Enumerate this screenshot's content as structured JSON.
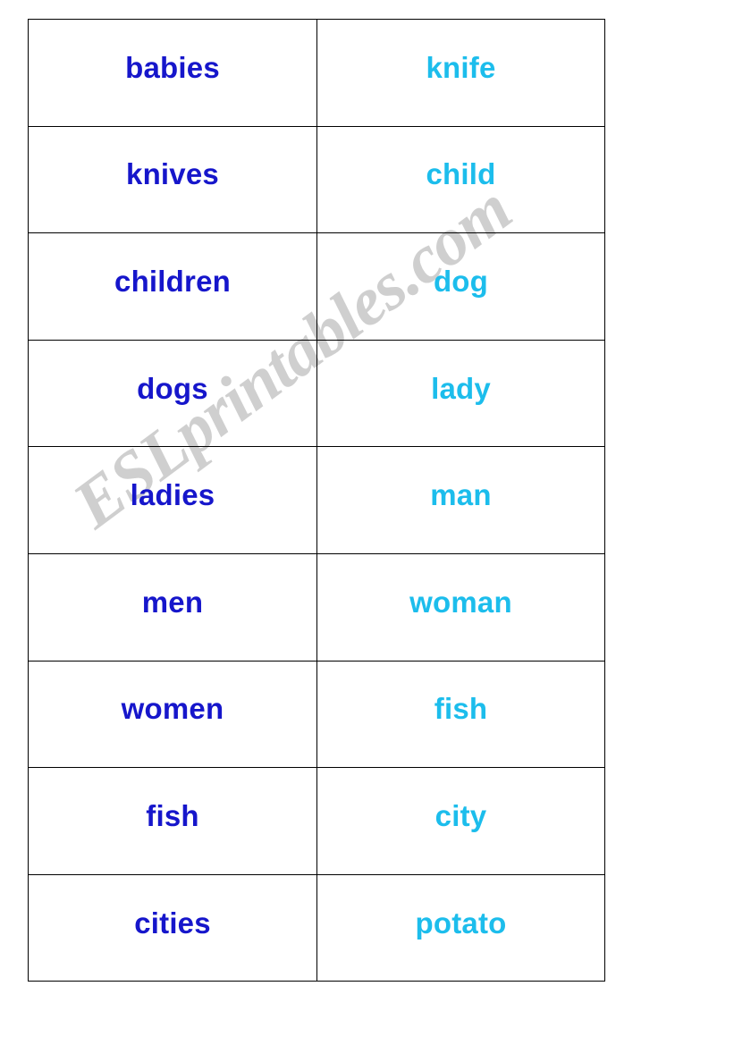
{
  "document": {
    "type": "vocabulary-flashcard-table",
    "columns": 2,
    "rows": 9,
    "colors": {
      "plural_word": "#1616cb",
      "singular_word": "#1cbdec",
      "border": "#000000",
      "background": "#ffffff",
      "watermark": "#cfcfcf"
    }
  },
  "watermark": {
    "text": "ESLprintables.com",
    "rotation_degrees": -36.5
  },
  "table": {
    "rows": [
      {
        "plural": "babies",
        "singular": "knife"
      },
      {
        "plural": "knives",
        "singular": "child"
      },
      {
        "plural": "children",
        "singular": "dog"
      },
      {
        "plural": "dogs",
        "singular": "lady"
      },
      {
        "plural": "ladies",
        "singular": "man"
      },
      {
        "plural": "men",
        "singular": "woman"
      },
      {
        "plural": "women",
        "singular": "fish"
      },
      {
        "plural": "fish",
        "singular": "city"
      },
      {
        "plural": "cities",
        "singular": "potato"
      }
    ]
  }
}
